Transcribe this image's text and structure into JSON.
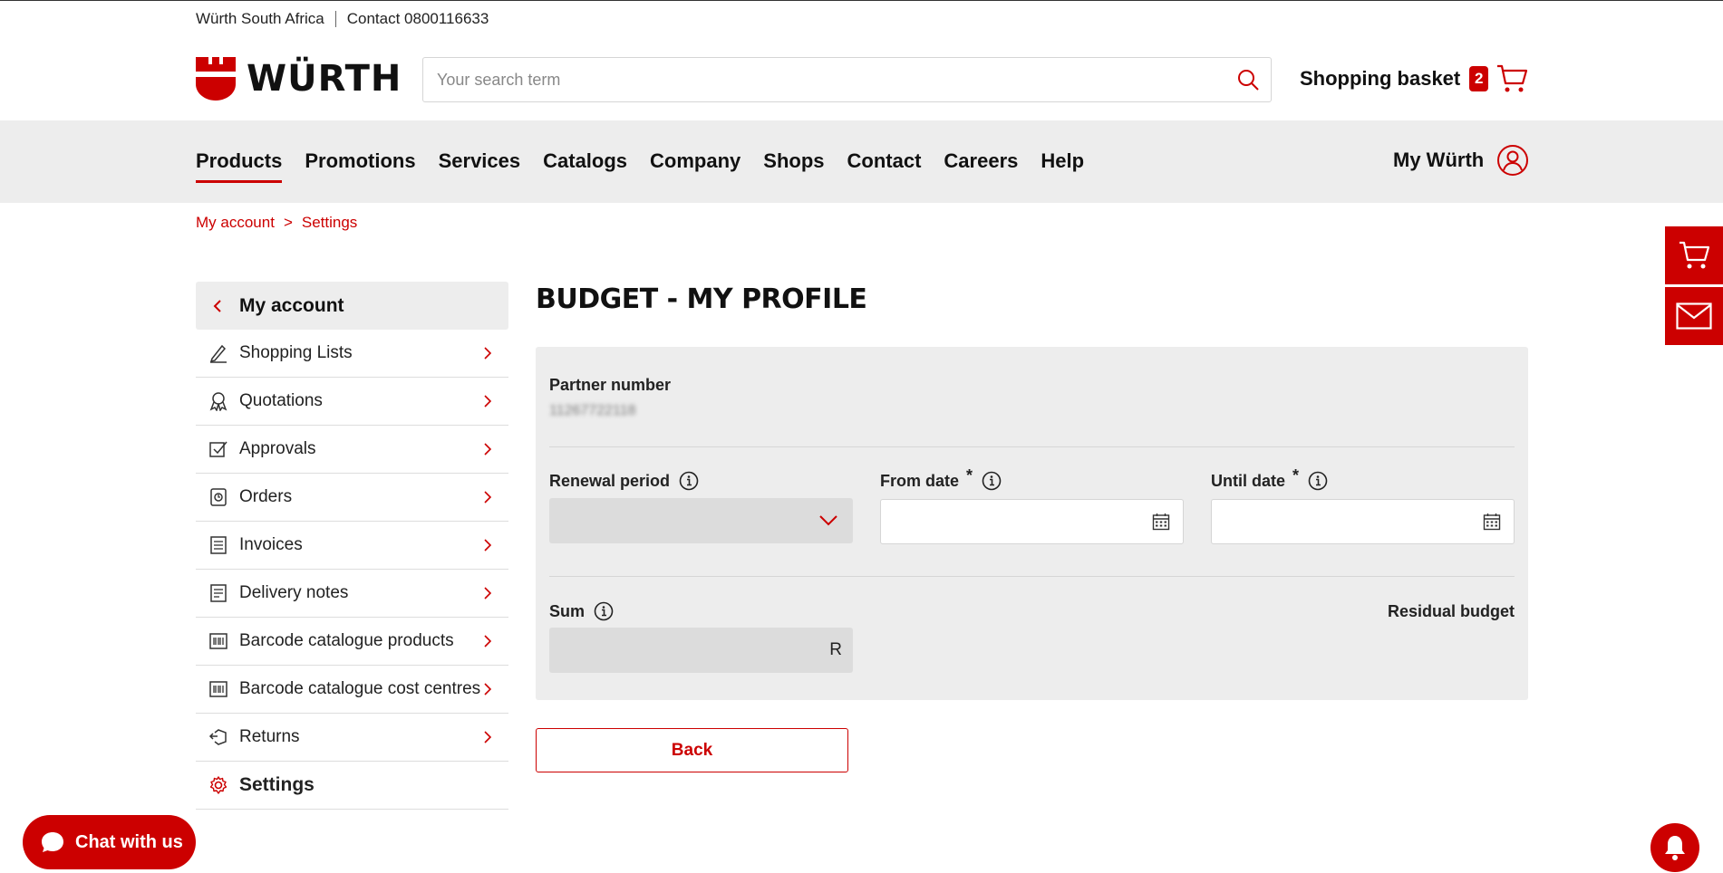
{
  "topbar": {
    "company": "Würth South Africa",
    "contact": "Contact 0800116633"
  },
  "logo": {
    "text": "WÜRTH"
  },
  "search": {
    "placeholder": "Your search term"
  },
  "basket": {
    "label": "Shopping basket",
    "count": "2"
  },
  "nav": {
    "items": [
      "Products",
      "Promotions",
      "Services",
      "Catalogs",
      "Company",
      "Shops",
      "Contact",
      "Careers",
      "Help"
    ],
    "active": "Products",
    "account_label": "My Würth"
  },
  "breadcrumb": {
    "items": [
      "My account",
      "Settings"
    ],
    "separator": ">"
  },
  "sidebar": {
    "head": "My account",
    "items": [
      {
        "label": "Shopping Lists",
        "icon": "pencil-icon"
      },
      {
        "label": "Quotations",
        "icon": "award-icon"
      },
      {
        "label": "Approvals",
        "icon": "checkbox-icon"
      },
      {
        "label": "Orders",
        "icon": "order-icon"
      },
      {
        "label": "Invoices",
        "icon": "invoice-icon"
      },
      {
        "label": "Delivery notes",
        "icon": "delivery-note-icon"
      },
      {
        "label": "Barcode catalogue products",
        "icon": "barcode-icon"
      },
      {
        "label": "Barcode catalogue cost centres",
        "icon": "barcode-icon"
      },
      {
        "label": "Returns",
        "icon": "returns-icon"
      },
      {
        "label": "Settings",
        "icon": "gear-icon"
      }
    ]
  },
  "page": {
    "title": "BUDGET - MY PROFILE"
  },
  "form": {
    "partner_number_label": "Partner number",
    "partner_number_value": "11267722118",
    "renewal_period_label": "Renewal period",
    "renewal_period_value": "",
    "from_date_label": "From date",
    "until_date_label": "Until date",
    "required_mark": "*",
    "sum_label": "Sum",
    "sum_currency": "R",
    "residual_budget_label": "Residual budget"
  },
  "buttons": {
    "back": "Back"
  },
  "chat": {
    "label": "Chat with us"
  },
  "colors": {
    "brand": "#cc0000",
    "panel": "#ededed",
    "nav_bg": "#ededed"
  }
}
